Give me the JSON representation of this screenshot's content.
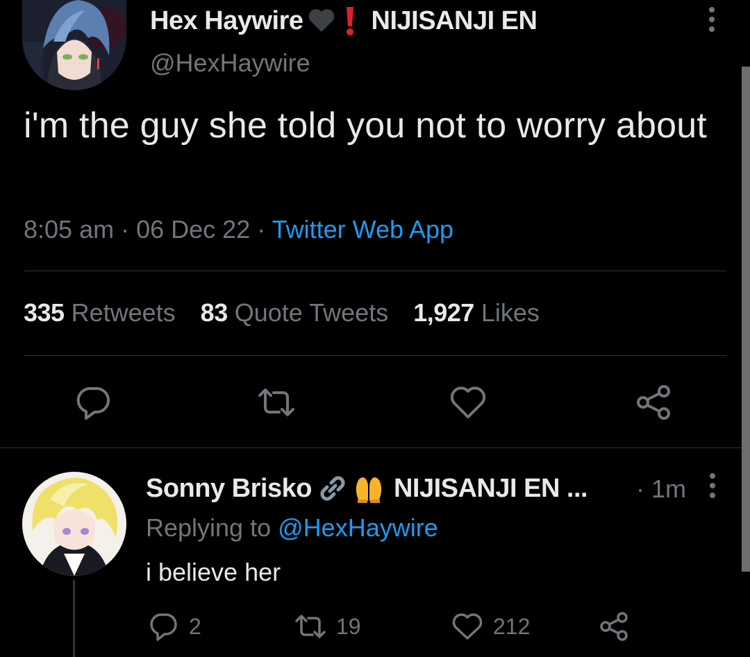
{
  "tweet": {
    "author": {
      "display_name": "Hex Haywire",
      "affiliation": "NIJISANJI EN",
      "handle": "@HexHaywire",
      "name_emojis": [
        "black-heart",
        "red-exclamation"
      ]
    },
    "text": "i'm the guy she told you not to worry about",
    "time": "8:05 am",
    "separator": "·",
    "date": "06 Dec 22",
    "source": "Twitter Web App",
    "stats": {
      "retweets_count": "335",
      "retweets_label": "Retweets",
      "quotes_count": "83",
      "quotes_label": "Quote Tweets",
      "likes_count": "1,927",
      "likes_label": "Likes"
    },
    "actions": [
      "reply",
      "retweet",
      "like",
      "share"
    ]
  },
  "reply": {
    "author": {
      "display_name": "Sonny Brisko",
      "affiliation": "NIJISANJI EN",
      "truncation": "...",
      "name_emojis": [
        "link",
        "raising-hands"
      ]
    },
    "time": "· 1m",
    "replying_prefix": "Replying to",
    "replying_to": "@HexHaywire",
    "text": "i believe her",
    "counts": {
      "replies": "2",
      "retweets": "19",
      "likes": "212"
    }
  },
  "colors": {
    "background": "#000000",
    "primary_text": "#e7e9ea",
    "secondary_text": "#71767b",
    "accent": "#1d9bf0",
    "divider": "#2f3336"
  }
}
